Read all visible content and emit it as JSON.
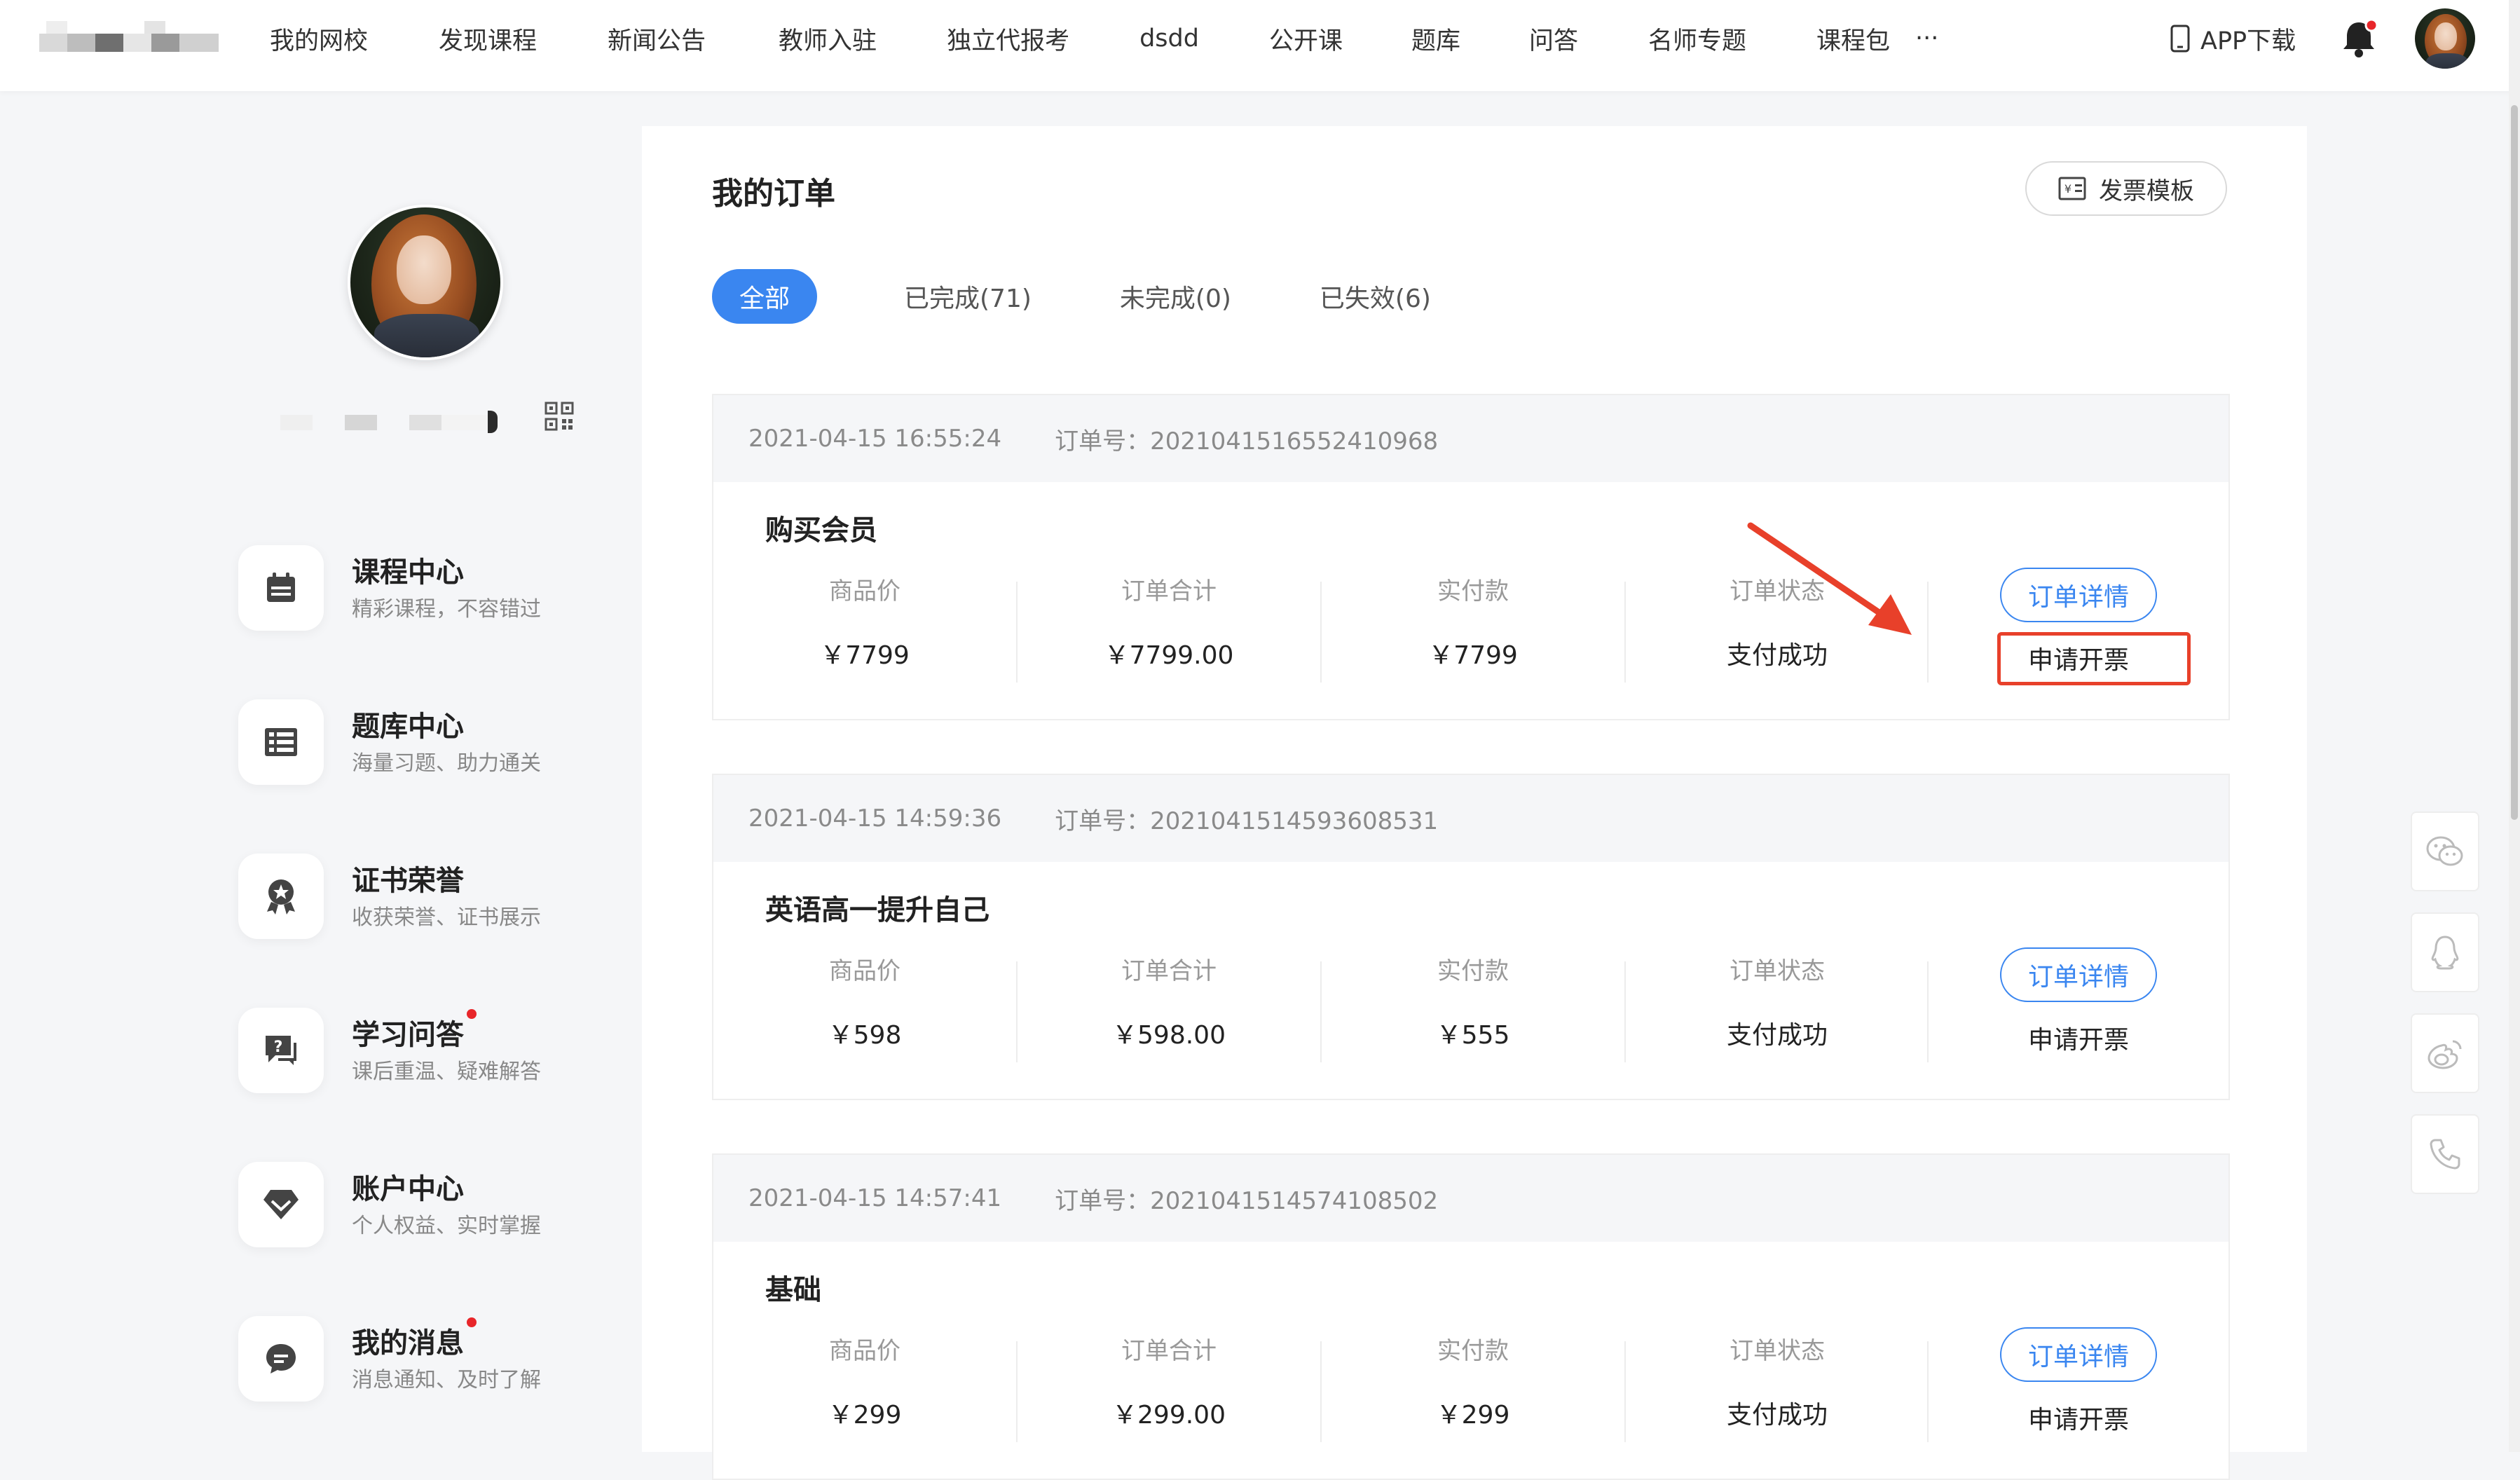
{
  "nav": {
    "items": [
      "我的网校",
      "发现课程",
      "新闻公告",
      "教师入驻",
      "独立代报考",
      "dsdd",
      "公开课",
      "题库",
      "问答",
      "名师专题",
      "课程包",
      "···"
    ],
    "app_download": "APP下载"
  },
  "sidebar": {
    "items": [
      {
        "title": "课程中心",
        "subtitle": "精彩课程，不容错过",
        "icon": "calendar-icon",
        "dot": false
      },
      {
        "title": "题库中心",
        "subtitle": "海量习题、助力通关",
        "icon": "question-bank-icon",
        "dot": false
      },
      {
        "title": "证书荣誉",
        "subtitle": "收获荣誉、证书展示",
        "icon": "medal-icon",
        "dot": false
      },
      {
        "title": "学习问答",
        "subtitle": "课后重温、疑难解答",
        "icon": "qa-icon",
        "dot": true
      },
      {
        "title": "账户中心",
        "subtitle": "个人权益、实时掌握",
        "icon": "diamond-icon",
        "dot": false
      },
      {
        "title": "我的消息",
        "subtitle": "消息通知、及时了解",
        "icon": "message-icon",
        "dot": true
      }
    ]
  },
  "main": {
    "title": "我的订单",
    "invoice_template": "发票模板",
    "tabs": [
      "全部",
      "已完成(71)",
      "未完成(0)",
      "已失效(6)"
    ],
    "active_tab": "全部",
    "column_labels": [
      "商品价",
      "订单合计",
      "实付款",
      "订单状态"
    ],
    "detail_button": "订单详情",
    "invoice_button": "申请开票",
    "orders": [
      {
        "time": "2021-04-15 16:55:24",
        "order_no": "订单号：2021041516552410968",
        "name": "购买会员",
        "price": "￥7799",
        "total": "￥7799.00",
        "paid": "￥7799",
        "status": "支付成功"
      },
      {
        "time": "2021-04-15 14:59:36",
        "order_no": "订单号：2021041514593608531",
        "name": "英语高一提升自己",
        "price": "￥598",
        "total": "￥598.00",
        "paid": "￥555",
        "status": "支付成功"
      },
      {
        "time": "2021-04-15 14:57:41",
        "order_no": "订单号：2021041514574108502",
        "name": "基础",
        "price": "￥299",
        "total": "￥299.00",
        "paid": "￥299",
        "status": "支付成功"
      }
    ]
  },
  "float_bar": [
    "wechat-icon",
    "qq-icon",
    "weibo-icon",
    "phone-icon"
  ],
  "colors": {
    "accent": "#3a86f0",
    "highlight": "#e8402a",
    "dot": "#e8262a"
  }
}
